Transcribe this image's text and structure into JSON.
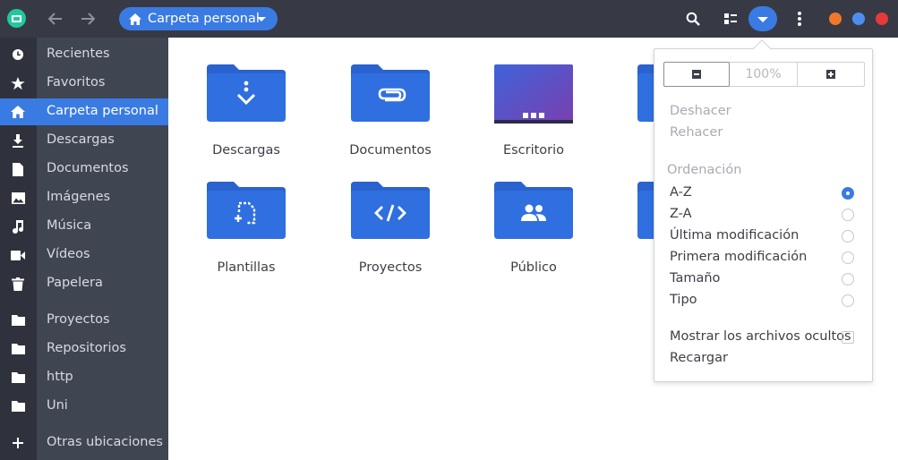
{
  "header": {
    "app_icon": "files-app-icon",
    "back_icon": "arrow-left-icon",
    "forward_icon": "arrow-right-icon",
    "path_label": "Carpeta personal",
    "path_icon": "home-icon",
    "search_icon": "search-icon",
    "view_icon": "list-view-icon",
    "menu_icon": "chevron-down-icon",
    "more_icon": "kebab-menu-icon",
    "window_controls": [
      {
        "name": "minimize",
        "color": "#f0782a"
      },
      {
        "name": "maximize",
        "color": "#4c8ef0"
      },
      {
        "name": "close",
        "color": "#e5393b"
      }
    ]
  },
  "sidebar": {
    "items": [
      {
        "label": "Recientes",
        "icon": "clock-icon"
      },
      {
        "label": "Favoritos",
        "icon": "star-icon"
      },
      {
        "label": "Carpeta personal",
        "icon": "home-icon",
        "active": true
      },
      {
        "label": "Descargas",
        "icon": "download-icon"
      },
      {
        "label": "Documentos",
        "icon": "document-icon"
      },
      {
        "label": "Imágenes",
        "icon": "image-icon"
      },
      {
        "label": "Música",
        "icon": "music-icon"
      },
      {
        "label": "Vídeos",
        "icon": "video-icon"
      },
      {
        "label": "Papelera",
        "icon": "trash-icon"
      },
      {
        "label": "Proyectos",
        "icon": "folder-icon"
      },
      {
        "label": "Repositorios",
        "icon": "folder-icon"
      },
      {
        "label": "http",
        "icon": "folder-icon"
      },
      {
        "label": "Uni",
        "icon": "folder-icon"
      },
      {
        "label": "Otras ubicaciones",
        "icon": "plus-icon"
      }
    ]
  },
  "files": [
    {
      "label": "Descargas",
      "icon": "download-folder-icon"
    },
    {
      "label": "Documentos",
      "icon": "documents-folder-icon"
    },
    {
      "label": "Escritorio",
      "icon": "desktop-folder-icon"
    },
    {
      "label": "Im",
      "icon": "pictures-folder-icon"
    },
    {
      "label": "Plantillas",
      "icon": "templates-folder-icon"
    },
    {
      "label": "Proyectos",
      "icon": "code-folder-icon"
    },
    {
      "label": "Público",
      "icon": "public-folder-icon"
    },
    {
      "label": "Re",
      "icon": "folder-icon"
    }
  ],
  "popover": {
    "zoom_value": "100%",
    "zoom_out_icon": "zoom-out-icon",
    "zoom_in_icon": "zoom-in-icon",
    "undo": "Deshacer",
    "redo": "Rehacer",
    "sort_heading": "Ordenación",
    "sort_options": [
      {
        "label": "A-Z",
        "selected": true
      },
      {
        "label": "Z-A",
        "selected": false
      },
      {
        "label": "Última modificación",
        "selected": false
      },
      {
        "label": "Primera modificación",
        "selected": false
      },
      {
        "label": "Tamaño",
        "selected": false
      },
      {
        "label": "Tipo",
        "selected": false
      }
    ],
    "show_hidden": "Mostrar los archivos ocultos",
    "show_hidden_checked": false,
    "reload": "Recargar"
  },
  "colors": {
    "accent": "#3a7be3",
    "folder": "#2f6fe0",
    "folder_tab": "#2a63cf",
    "desktop_grad_start": "#3f63d8",
    "desktop_grad_end": "#7a3fb0"
  }
}
